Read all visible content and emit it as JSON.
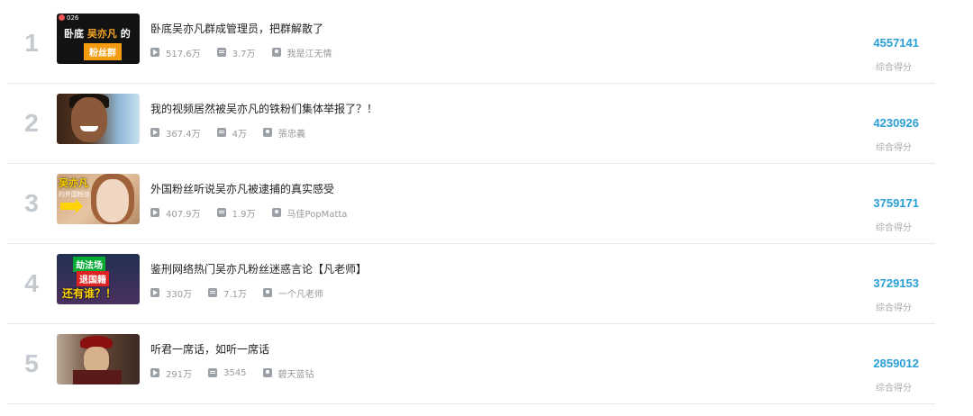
{
  "ranking": {
    "score_label": "综合得分",
    "items": [
      {
        "rank": "1",
        "title": "卧底吴亦凡群成管理员，把群解散了",
        "plays": "517.6万",
        "danmaku": "3.7万",
        "uploader": "我是江无情",
        "score": "4557141",
        "thumb_text": {
          "badge": "026",
          "line1_a": "卧底",
          "line1_b": "吴亦凡",
          "line1_c": "的",
          "line2": "粉丝群"
        }
      },
      {
        "rank": "2",
        "title": "我的视频居然被吴亦凡的铁粉们集体举报了？！",
        "plays": "367.4万",
        "danmaku": "4万",
        "uploader": "張忠義",
        "score": "4230926"
      },
      {
        "rank": "3",
        "title": "外国粉丝听说吴亦凡被逮捕的真实感受",
        "plays": "407.9万",
        "danmaku": "1.9万",
        "uploader": "马佳PopMatta",
        "score": "3759171",
        "thumb_text": {
          "line1": "吴亦凡",
          "line2": "的外国粉丝"
        }
      },
      {
        "rank": "4",
        "title": "鉴刑网络热门吴亦凡粉丝迷惑言论【凡老师】",
        "plays": "330万",
        "danmaku": "7.1万",
        "uploader": "一个凡老师",
        "score": "3729153",
        "thumb_text": {
          "line1": "劫法场",
          "line2": "退国籍",
          "line3": "还有谁？！"
        }
      },
      {
        "rank": "5",
        "title": "听君一席话，如听一席话",
        "plays": "291万",
        "danmaku": "3545",
        "uploader": "碧天蓝钻",
        "score": "2859012"
      }
    ]
  },
  "icons": {
    "plays": "play-count-icon",
    "danmaku": "danmaku-icon",
    "uploader": "uploader-icon"
  },
  "colors": {
    "score": "#2a9fd6",
    "rank": "#c5c9d0"
  }
}
